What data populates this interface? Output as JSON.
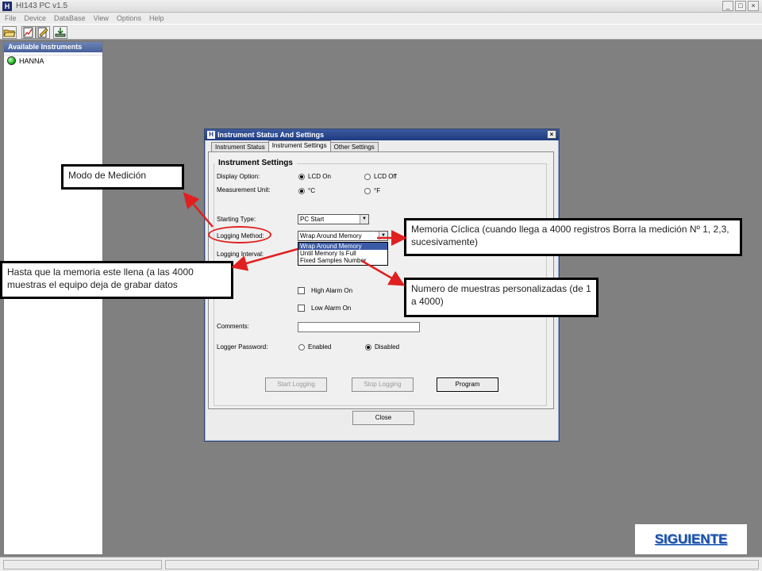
{
  "window": {
    "title": "HI143 PC v1.5",
    "app_icon": "H",
    "controls": [
      "_",
      "□",
      "×"
    ]
  },
  "menu": [
    "File",
    "Device",
    "DataBase",
    "View",
    "Options",
    "Help"
  ],
  "toolbar": {
    "icons": [
      "open-folder-icon",
      "chart-icon",
      "edit-icon",
      "download-icon"
    ]
  },
  "panel": {
    "title": "Available Instruments",
    "instrument": "HANNA"
  },
  "dialog": {
    "title": "Instrument Status And Settings",
    "icon": "H",
    "close": "×",
    "tabs": [
      "Instrument Status",
      "Instrument Settings",
      "Other Settings"
    ],
    "active_tab": 1,
    "group": "Instrument Settings",
    "display_option": {
      "label": "Display Option:",
      "options": [
        "LCD On",
        "LCD Off"
      ],
      "selected": 0
    },
    "measurement_unit": {
      "label": "Measurement Unit:",
      "options": [
        "°C",
        "°F"
      ],
      "selected": 0
    },
    "starting_type": {
      "label": "Starting Type:",
      "value": "PC Start"
    },
    "logging_method": {
      "label": "Logging Method:",
      "value": "Wrap Around Memory",
      "options": [
        "Wrap Around Memory",
        "Until Memory Is Full",
        "Fixed Samples Number"
      ]
    },
    "logging_interval": {
      "label": "Logging Interval:"
    },
    "high_alarm": "High Alarm On",
    "low_alarm": "Low Alarm On",
    "comments": {
      "label": "Comments:",
      "value": ""
    },
    "password": {
      "label": "Logger Password:",
      "options": [
        "Enabled",
        "Disabled"
      ],
      "selected": 1
    },
    "buttons": {
      "start": "Start Logging",
      "stop": "Stop Logging",
      "program": "Program",
      "close": "Close"
    }
  },
  "annotations": {
    "mode": "Modo de Medición",
    "until_full": "Hasta que la memoria este llena (a las 4000 muestras el equipo deja de grabar datos",
    "wrap": "Memoria Cíclica (cuando llega a 4000 registros Borra la medición Nº 1, 2,3, sucesivamente)",
    "fixed": "Numero de muestras personalizadas (de 1 a 4000)",
    "arrow_color": "#e02020"
  },
  "next_link": "SIGUIENTE"
}
